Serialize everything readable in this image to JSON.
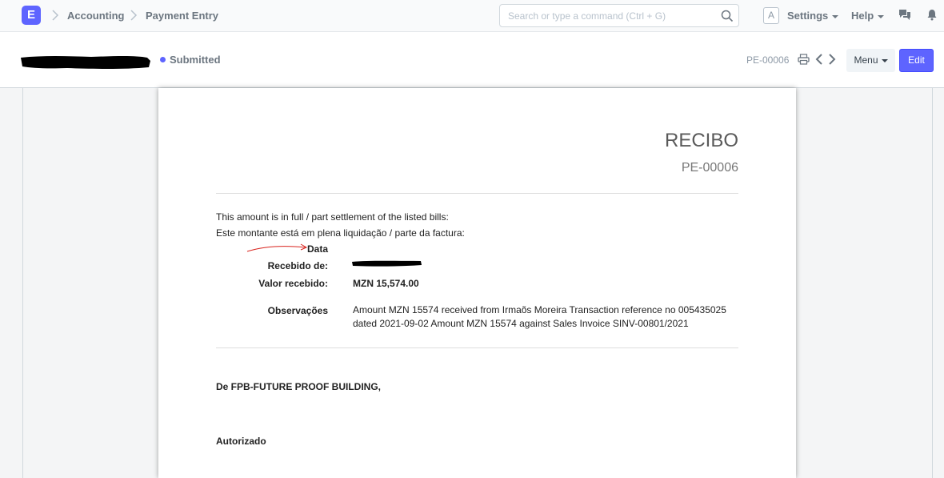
{
  "navbar": {
    "logo_letter": "E",
    "breadcrumbs": [
      "Accounting",
      "Payment Entry"
    ],
    "search_placeholder": "Search or type a command (Ctrl + G)",
    "avatar_letter": "A",
    "settings_label": "Settings",
    "help_label": "Help"
  },
  "page_head": {
    "status": "Submitted",
    "doc_name": "PE-00006",
    "menu_label": "Menu",
    "edit_label": "Edit"
  },
  "receipt": {
    "title": "RECIBO",
    "doc_no": "PE-00006",
    "settlement_en": "This amount is in full / part settlement of the listed bills:",
    "settlement_pt": "Este montante está em plena liquidação / parte da factura:",
    "date_label": "Data",
    "received_from_label": "Recebido de:",
    "amount_label": "Valor recebido:",
    "amount_value": "MZN 15,574.00",
    "remarks_label": "Observações",
    "remarks_line1": "Amount MZN 15574 received from Irmaõs Moreira Transaction reference no 005435025",
    "remarks_line2": "dated 2021-09-02 Amount MZN 15574 against Sales Invoice SINV-00801/2021",
    "from_company": "De FPB-FUTURE PROOF BUILDING,",
    "authorized": "Autorizado"
  },
  "colors": {
    "primary": "#5e64ff",
    "annotation_red": "#d9231d"
  }
}
